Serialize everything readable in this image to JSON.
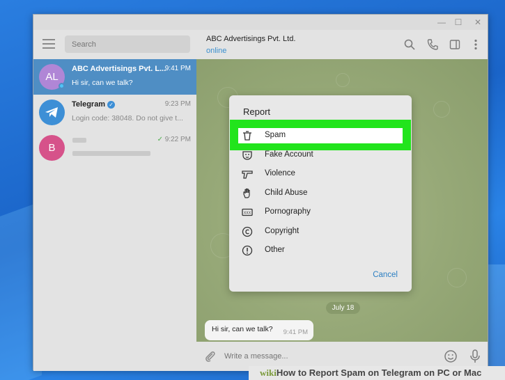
{
  "window": {
    "controls": {
      "minimize": "—",
      "maximize": "☐",
      "close": "✕"
    }
  },
  "sidebar": {
    "search_placeholder": "Search",
    "chats": [
      {
        "initials": "AL",
        "name": "ABC Advertisings Pvt. L...",
        "time": "9:41 PM",
        "preview": "Hi sir, can we talk?",
        "avatar_color": "#b086d6",
        "active": true
      },
      {
        "initials": "",
        "name": "Telegram",
        "time": "9:23 PM",
        "preview": "Login code: 38048. Do not give t...",
        "avatar_color": "#3d8fd6",
        "verified": true
      },
      {
        "initials": "B",
        "name": "",
        "time": "9:22 PM",
        "preview": "",
        "avatar_color": "#d6528a",
        "read_check": "✓"
      }
    ]
  },
  "header": {
    "contact_name": "ABC Advertisings Pvt. Ltd.",
    "status": "online"
  },
  "chat": {
    "date_pill": "July 18",
    "message": {
      "text": "Hi sir, can we talk?",
      "time": "9:41 PM"
    },
    "input_placeholder": "Write a message..."
  },
  "report_dialog": {
    "title": "Report",
    "options": [
      {
        "label": "Spam",
        "icon": "trash-icon"
      },
      {
        "label": "Fake Account",
        "icon": "mask-icon"
      },
      {
        "label": "Violence",
        "icon": "gun-icon"
      },
      {
        "label": "Child Abuse",
        "icon": "hand-icon"
      },
      {
        "label": "Pornography",
        "icon": "xxx-icon"
      },
      {
        "label": "Copyright",
        "icon": "copyright-icon"
      },
      {
        "label": "Other",
        "icon": "info-icon"
      }
    ],
    "cancel_label": "Cancel",
    "highlight_color": "#22e41c"
  },
  "watermark": {
    "brand": "wiki",
    "text": "How to Report Spam on Telegram on PC or Mac"
  }
}
